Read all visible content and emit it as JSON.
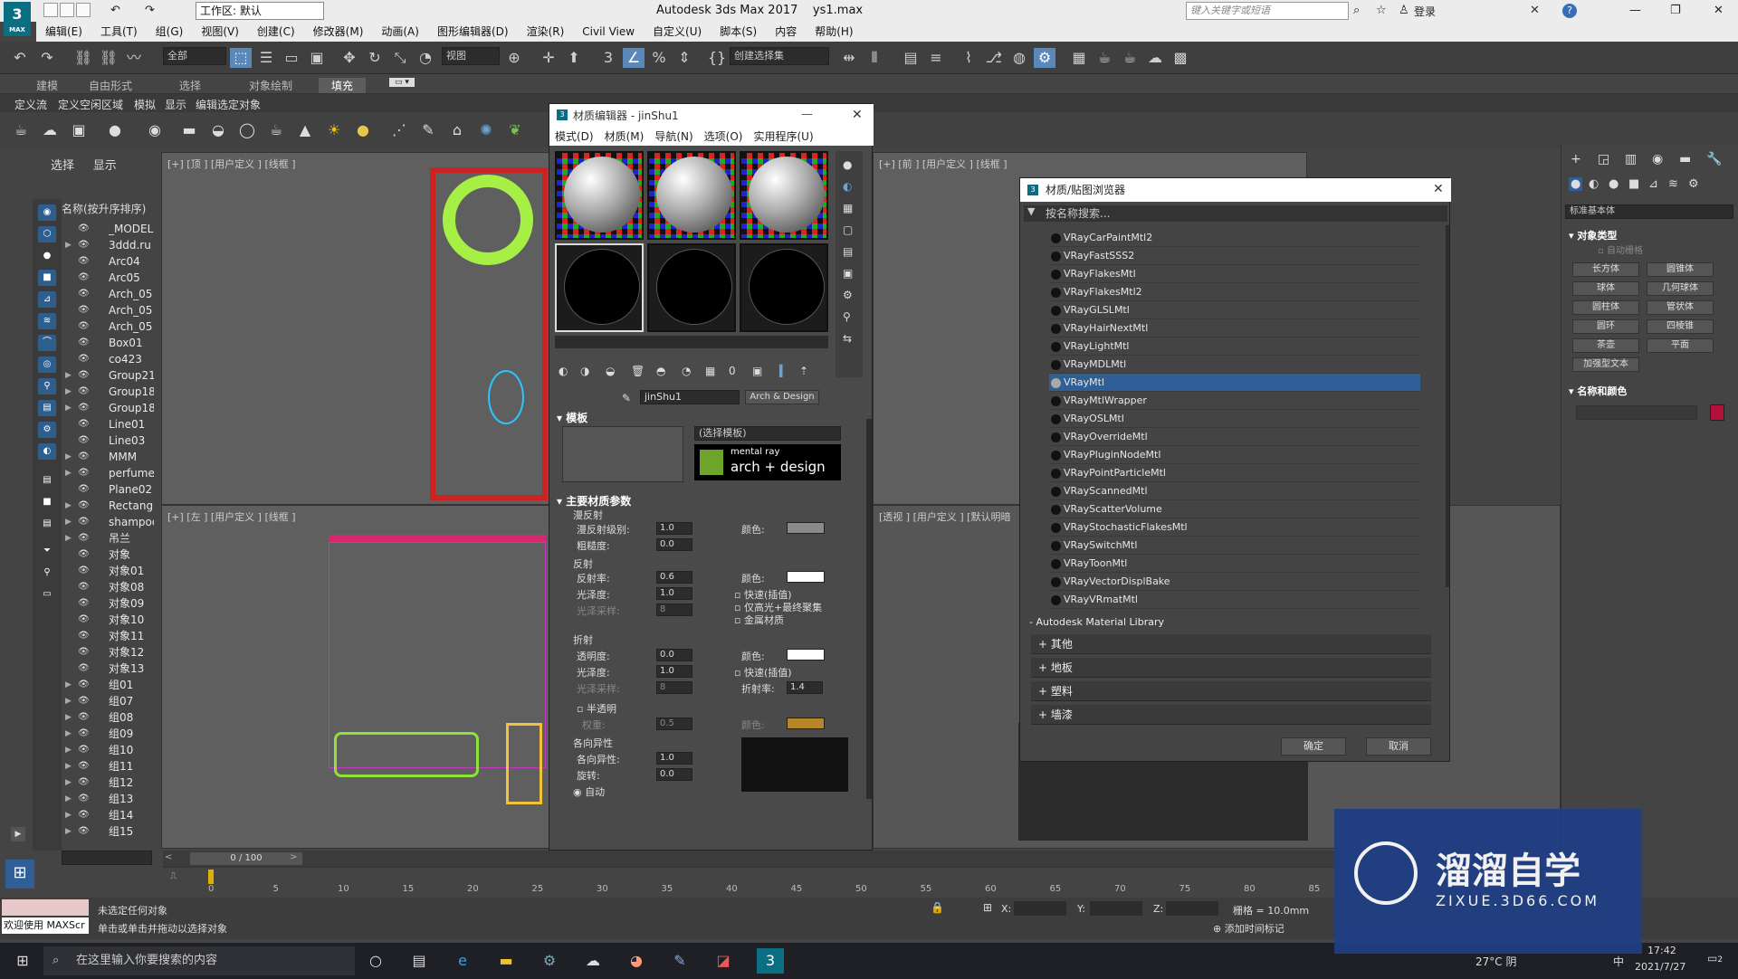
{
  "app": {
    "title": "Autodesk 3ds Max 2017",
    "file": "ys1.max",
    "logo": "3",
    "logo_sub": "MAX",
    "workspace": "工作区: 默认",
    "search_placeholder": "键入关键字或短语",
    "login": "登录",
    "help": "?"
  },
  "menu": [
    "编辑(E)",
    "工具(T)",
    "组(G)",
    "视图(V)",
    "创建(C)",
    "修改器(M)",
    "动画(A)",
    "图形编辑器(D)",
    "渲染(R)",
    "Civil View",
    "自定义(U)",
    "脚本(S)",
    "内容",
    "帮助(H)"
  ],
  "toolbar": {
    "filter": "全部",
    "ref_coord": "视图",
    "selection_set": "创建选择集"
  },
  "ribbon": {
    "tabs": [
      "建模",
      "自由形式",
      "选择",
      "对象绘制",
      "填充"
    ],
    "active": "填充",
    "sub": [
      "定义流",
      "定义空闲区域",
      "模拟",
      "显示",
      "编辑选定对象"
    ]
  },
  "scene_explorer": {
    "tabs": [
      "选择",
      "显示"
    ],
    "header": "名称(按升序排序)",
    "items": [
      "_MODEL",
      "3ddd.ru",
      "Arc04",
      "Arc05",
      "Arch_05",
      "Arch_05",
      "Arch_05",
      "Box01",
      "co423",
      "Group21",
      "Group18",
      "Group18",
      "Line01",
      "Line03",
      "MMM",
      "perfume",
      "Plane02",
      "Rectangl",
      "shampoo",
      "吊兰",
      "对象",
      "对象01",
      "对象08",
      "对象09",
      "对象10",
      "对象11",
      "对象12",
      "对象13",
      "组01",
      "组07",
      "组08",
      "组09",
      "组10",
      "组11",
      "组12",
      "组13",
      "组14",
      "组15"
    ]
  },
  "viewports": {
    "top": "[+] [顶 ] [用户定义 ] [线框 ]",
    "left": "[+] [左 ] [用户定义 ] [线框 ]",
    "front": "[+] [前 ] [用户定义 ] [线框 ]",
    "persp": "[透视 ] [用户定义 ] [默认明暗"
  },
  "material_editor": {
    "title": "材质编辑器 - jinShu1",
    "menu": [
      "模式(D)",
      "材质(M)",
      "导航(N)",
      "选项(O)",
      "实用程序(U)"
    ],
    "mat_name": "jinShu1",
    "mat_type": "Arch & Design",
    "template_roll": "模板",
    "template_select": "(选择模板)",
    "mr_line1": "mental ray",
    "mr_line2": "arch + design",
    "main_roll": "主要材质参数",
    "diffuse": "漫反射",
    "diffuse_level_lbl": "漫反射级别:",
    "diffuse_level": "1.0",
    "roughness_lbl": "粗糙度:",
    "roughness": "0.0",
    "color_lbl": "颜色:",
    "reflection": "反射",
    "reflectivity_lbl": "反射率:",
    "reflectivity": "0.6",
    "gloss_lbl": "光泽度:",
    "gloss": "1.0",
    "gloss_samples_lbl": "光泽采样:",
    "gloss_samples": "8",
    "fast_interp": "快速(插值)",
    "highlight_fg": "仅高光+最终聚集",
    "metal": "金属材质",
    "refraction": "折射",
    "transparency_lbl": "透明度:",
    "transparency": "0.0",
    "refr_gloss": "1.0",
    "refr_samples": "8",
    "ior_lbl": "折射率:",
    "ior": "1.4",
    "translucency": "半透明",
    "weight_lbl": "权重:",
    "weight": "0.5",
    "anisotropy": "各向异性",
    "aniso_lbl": "各向异性:",
    "aniso": "1.0",
    "rotation_lbl": "旋转:",
    "rotation": "0.0",
    "auto": "自动",
    "colors": {
      "diffuse": "#8a8a8a",
      "reflect": "#ffffff",
      "refract": "#ffffff",
      "translucent": "#b8862a"
    }
  },
  "mat_browser": {
    "title": "材质/贴图浏览器",
    "search": "按名称搜索...",
    "items": [
      "VRayCarPaintMtl2",
      "VRayFastSSS2",
      "VRayFlakesMtl",
      "VRayFlakesMtl2",
      "VRayGLSLMtl",
      "VRayHairNextMtl",
      "VRayLightMtl",
      "VRayMDLMtl",
      "VRayMtl",
      "VRayMtlWrapper",
      "VRayOSLMtl",
      "VRayOverrideMtl",
      "VRayPluginNodeMtl",
      "VRayPointParticleMtl",
      "VRayScannedMtl",
      "VRayScatterVolume",
      "VRayStochasticFlakesMtl",
      "VRaySwitchMtl",
      "VRayToonMtl",
      "VRayVectorDisplBake",
      "VRayVRmatMtl"
    ],
    "selected": "VRayMtl",
    "library": "- Autodesk Material Library",
    "categories": [
      "+ 其他",
      "+ 地板",
      "+ 塑料",
      "+ 墙漆"
    ],
    "ok": "确定",
    "cancel": "取消"
  },
  "command_panel": {
    "dropdown": "标准基本体",
    "obj_type": "对象类型",
    "autogrid": "自动栅格",
    "buttons": [
      "长方体",
      "圆锥体",
      "球体",
      "几何球体",
      "圆柱体",
      "管状体",
      "圆环",
      "四棱锥",
      "茶壶",
      "平面",
      "加强型文本"
    ],
    "name_color": "名称和颜色",
    "color": "#b0103a"
  },
  "timeline": {
    "frame": "0 / 100",
    "ticks": [
      "0",
      "5",
      "10",
      "15",
      "20",
      "25",
      "30",
      "35",
      "40",
      "45",
      "50",
      "55",
      "60",
      "65",
      "70",
      "75",
      "80",
      "85"
    ]
  },
  "status": {
    "maxscript": "欢迎使用 MAXScr",
    "line1": "未选定任何对象",
    "line2": "单击或单击并拖动以选择对象",
    "x_lbl": "X:",
    "y_lbl": "Y:",
    "z_lbl": "Z:",
    "grid": "栅格 = 10.0mm",
    "add_tag": "添加时间标记"
  },
  "taskbar": {
    "search": "在这里输入你要搜索的内容",
    "weather": "27°C 阴",
    "ime": "中",
    "time": "17:42",
    "date": "2021/7/27",
    "notif": "2"
  },
  "watermark": {
    "brand": "溜溜自学",
    "url": "ZIXUE.3D66.COM"
  }
}
